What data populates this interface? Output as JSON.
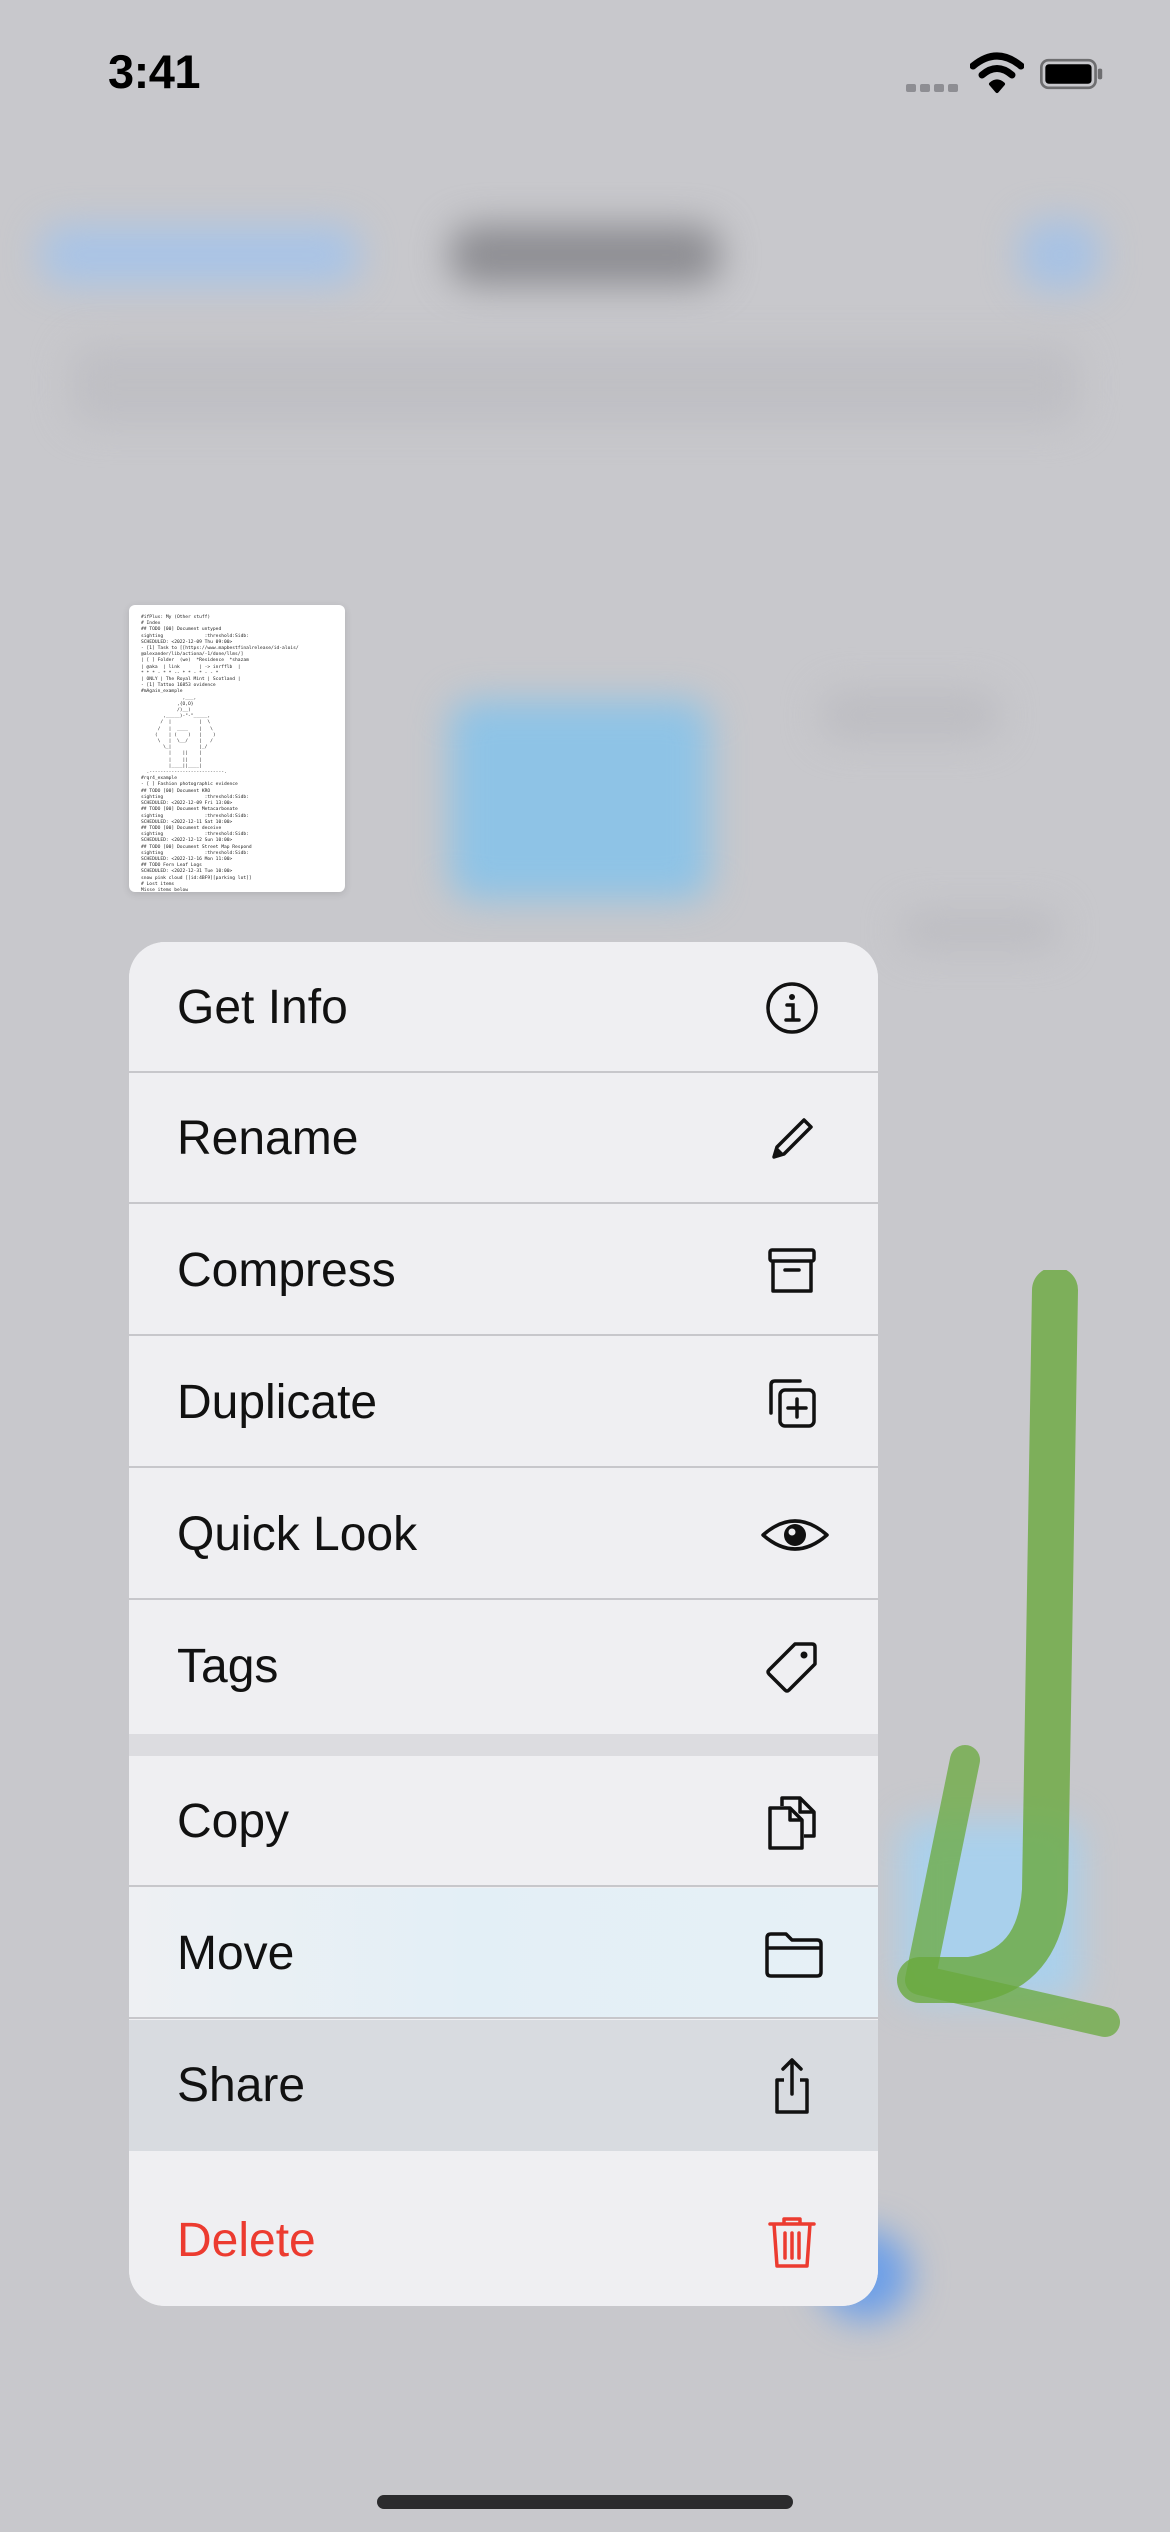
{
  "status_bar": {
    "time": "3:41"
  },
  "document": {
    "preview_text": "#ifPlus: My (Other stuff)\n# Index\n## TODO [00] Document untyped\nsighting               :threshold:Sidb:\nSCHEDULED: <2022-12-09 Thu 09:00>\n- [1] Task to [[https://www.mapbestfinalrelease/id-alois/\n@alexander/lib/actiona/-1/done/llms/]\n| [ ] Folder  (we)  *Residence  *shazam\n| @aka  | link       | -> inrfflb  |\n* * * - * * -- * * - * - - *\n| ONLY | The Royal Mint | Scotland |\n- [1] Tattoo 16853 ovidence\n#mAgain_example\n               ,___,\n             ,{O,O}\n             /)__)  \n        ,_____)-\"-\"_____,\n       /  |          |  \\\n      /   |  ____    |   \\\n     (    | (    )   |    )\n      \\   |  \\__/    |   /\n        \\_|          |_/\n          |    ||    |\n          |    ||    |\n          |____||____|\n  .---------------------------.\n#rqr4_example\n- [ ] Fashion photographic evidence\n## TODO [00] Document KRO\nsighting               :threshold:Sidb:\nSCHEDULED: <2022-12-09 Fri 13:00>\n## TODO [00] Document Metacarbonate\nsighting               :threshold:Sidb:\nSCHEDULED: <2022-12-11 Sat 10:00>\n## TODO [00] Document deceive\nsighting               :threshold:Sidb:\nSCHEDULED: <2022-12-12 Sun 10:00>\n## TODO [00] Document Street Map Respond\nsighting               :threshold:Sidb:\nSCHEDULED: <2022-12-16 Mon 11:00>\n## TODO Fern Leaf Logs\nSCHEDULED: <2022-12-31 Tue 10:00>\nsnow pink cloud [[id:4BF9][parking lot]]\n# Lost items\nMisse items below"
  },
  "menu": {
    "items": [
      {
        "label": "Get Info",
        "icon": "info-circle-icon"
      },
      {
        "label": "Rename",
        "icon": "pencil-icon"
      },
      {
        "label": "Compress",
        "icon": "archive-box-icon"
      },
      {
        "label": "Duplicate",
        "icon": "duplicate-plus-icon"
      },
      {
        "label": "Quick Look",
        "icon": "eye-icon"
      },
      {
        "label": "Tags",
        "icon": "tag-icon"
      },
      {
        "label": "Copy",
        "icon": "documents-icon"
      },
      {
        "label": "Move",
        "icon": "folder-icon"
      },
      {
        "label": "Share",
        "icon": "share-icon"
      },
      {
        "label": "Delete",
        "icon": "trash-icon"
      }
    ]
  },
  "colors": {
    "menu_background": "#efeff2",
    "delete_red": "#ec3b30",
    "highlight_share": "#d8dbe0",
    "background_blur": "#c8c8cc",
    "annotation_green": "#6aa93d"
  }
}
